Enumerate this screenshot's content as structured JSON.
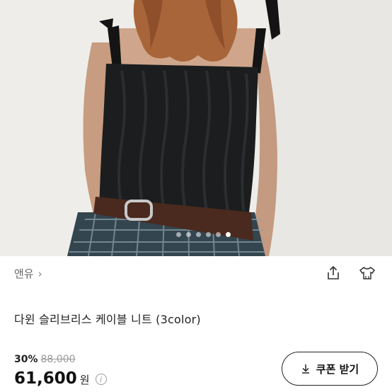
{
  "product": {
    "brand": "앤유",
    "brand_chevron": "›",
    "title": "다윈 슬리브리스 케이블 니트 (3color)",
    "discount": "30%",
    "original_price": "88,000",
    "price": "61,600",
    "currency": "원",
    "info_glyph": "i"
  },
  "carousel": {
    "total": 6,
    "active_index": 5
  },
  "actions": {
    "share_icon": "share-icon",
    "outfit_icon": "tshirt-icon"
  },
  "coupon": {
    "arrow": "↓",
    "label": "쿠폰 받기"
  }
}
